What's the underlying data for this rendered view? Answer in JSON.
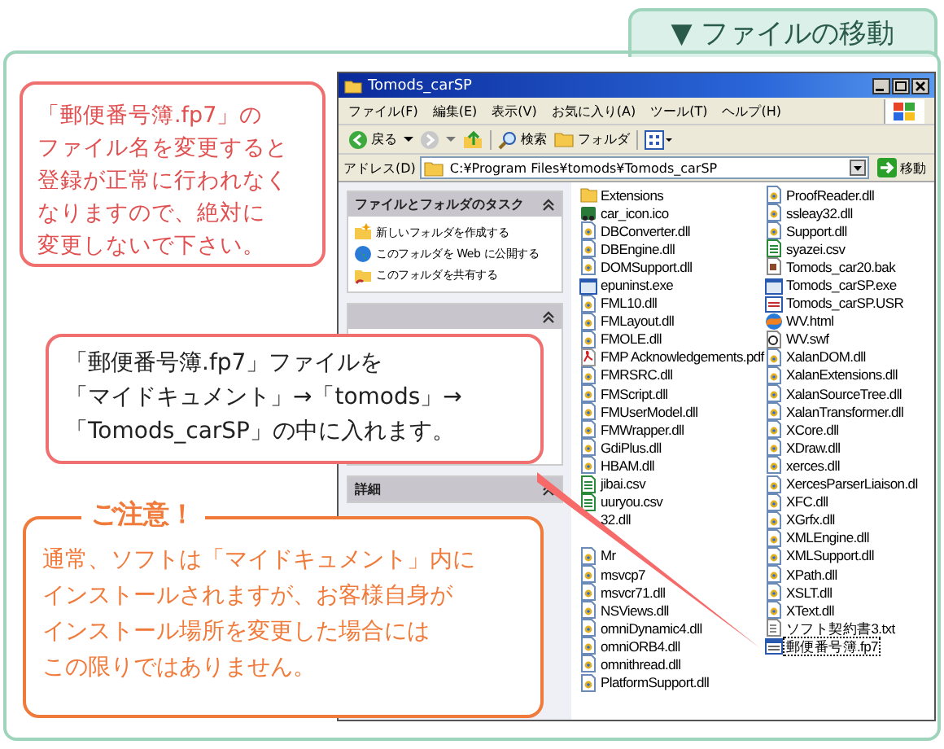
{
  "section_tab": {
    "label": "▼ ファイルの移動"
  },
  "window": {
    "title": "Tomods_carSP",
    "menu": [
      "ファイル(F)",
      "編集(E)",
      "表示(V)",
      "お気に入り(A)",
      "ツール(T)",
      "ヘルプ(H)"
    ],
    "toolbar": [
      {
        "kind": "back",
        "label": "戻る"
      },
      {
        "kind": "forward"
      },
      {
        "kind": "up"
      },
      {
        "kind": "search",
        "label": "検索"
      },
      {
        "kind": "folders",
        "label": "フォルダ"
      },
      {
        "kind": "views"
      }
    ],
    "address": {
      "label": "アドレス(D)",
      "value": "C:¥Program Files¥tomods¥Tomods_carSP",
      "go": "移動"
    },
    "task_panels": [
      {
        "title": "ファイルとフォルダのタスク",
        "expanded": true,
        "items": [
          {
            "kind": "new-folder",
            "label": "新しいフォルダを作成する"
          },
          {
            "kind": "web",
            "label": "このフォルダを Web に公開する"
          },
          {
            "kind": "share",
            "label": "このフォルダを共有する"
          }
        ]
      },
      {
        "expanded": true
      },
      {
        "title": "詳細",
        "expanded": true
      }
    ],
    "file_columns": [
      [
        {
          "name": "Extensions",
          "kind": "folder",
          "selected": false
        },
        {
          "name": "car_icon.ico",
          "kind": "ico",
          "selected": false
        },
        {
          "name": "DBConverter.dll",
          "kind": "dll",
          "selected": false
        },
        {
          "name": "DBEngine.dll",
          "kind": "dll",
          "selected": false
        },
        {
          "name": "DOMSupport.dll",
          "kind": "dll",
          "selected": false
        },
        {
          "name": "epuninst.exe",
          "kind": "exe",
          "selected": false
        },
        {
          "name": "FML10.dll",
          "kind": "dll",
          "selected": false
        },
        {
          "name": "FMLayout.dll",
          "kind": "dll",
          "selected": false
        },
        {
          "name": "FMOLE.dll",
          "kind": "dll",
          "selected": false
        },
        {
          "name": "FMP Acknowledgements.pdf",
          "kind": "pdf",
          "selected": false
        },
        {
          "name": "FMRSRC.dll",
          "kind": "dll",
          "selected": false
        },
        {
          "name": "FMScript.dll",
          "kind": "dll",
          "selected": false
        },
        {
          "name": "FMUserModel.dll",
          "kind": "dll",
          "selected": false
        },
        {
          "name": "FMWrapper.dll",
          "kind": "dll",
          "selected": false
        },
        {
          "name": "GdiPlus.dll",
          "kind": "dll",
          "selected": false
        },
        {
          "name": "HBAM.dll",
          "kind": "dll",
          "selected": false
        },
        {
          "name": "jibai.csv",
          "kind": "csv",
          "selected": false
        },
        {
          "name": "uuryou.csv",
          "kind": "csv",
          "selected": false
        },
        {
          "name": "32.dll",
          "selected": false
        },
        {
          "name": "Mr",
          "kind": "dll",
          "selected": false
        },
        {
          "name": "msvcp7",
          "kind": "dll",
          "selected": false
        },
        {
          "name": "msvcr71.dll",
          "kind": "dll",
          "selected": false
        },
        {
          "name": "NSViews.dll",
          "kind": "dll",
          "selected": false
        },
        {
          "name": "omniDynamic4.dll",
          "kind": "dll",
          "selected": false
        },
        {
          "name": "omniORB4.dll",
          "kind": "dll",
          "selected": false
        },
        {
          "name": "omnithread.dll",
          "kind": "dll",
          "selected": false
        },
        {
          "name": "PlatformSupport.dll",
          "kind": "dll",
          "selected": false
        }
      ],
      [
        {
          "name": "ProofReader.dll",
          "kind": "dll",
          "selected": false
        },
        {
          "name": "ssleay32.dll",
          "kind": "dll",
          "selected": false
        },
        {
          "name": "Support.dll",
          "kind": "dll",
          "selected": false
        },
        {
          "name": "syazei.csv",
          "kind": "csv",
          "selected": false
        },
        {
          "name": "Tomods_car20.bak",
          "kind": "bak",
          "selected": false
        },
        {
          "name": "Tomods_carSP.exe",
          "kind": "exe",
          "selected": false
        },
        {
          "name": "Tomods_carSP.USR",
          "kind": "usr",
          "selected": false
        },
        {
          "name": "WV.html",
          "kind": "html",
          "selected": false
        },
        {
          "name": "WV.swf",
          "kind": "swf",
          "selected": false
        },
        {
          "name": "XalanDOM.dll",
          "kind": "dll",
          "selected": false
        },
        {
          "name": "XalanExtensions.dll",
          "kind": "dll",
          "selected": false
        },
        {
          "name": "XalanSourceTree.dll",
          "kind": "dll",
          "selected": false
        },
        {
          "name": "XalanTransformer.dll",
          "kind": "dll",
          "selected": false
        },
        {
          "name": "XCore.dll",
          "kind": "dll",
          "selected": false
        },
        {
          "name": "XDraw.dll",
          "kind": "dll",
          "selected": false
        },
        {
          "name": "xerces.dll",
          "kind": "dll",
          "selected": false
        },
        {
          "name": "XercesParserLiaison.dl",
          "kind": "dll",
          "selected": false
        },
        {
          "name": "XFC.dll",
          "kind": "dll",
          "selected": false
        },
        {
          "name": "XGrfx.dll",
          "kind": "dll",
          "selected": false
        },
        {
          "name": "XMLEngine.dll",
          "kind": "dll",
          "selected": false
        },
        {
          "name": "XMLSupport.dll",
          "kind": "dll",
          "selected": false
        },
        {
          "name": "XPath.dll",
          "kind": "dll",
          "selected": false
        },
        {
          "name": "XSLT.dll",
          "kind": "dll",
          "selected": false
        },
        {
          "name": "XText.dll",
          "kind": "dll",
          "selected": false
        },
        {
          "name": "ソフト契約書3.txt",
          "kind": "txt",
          "selected": false
        },
        {
          "name": "郵便番号簿.fp7",
          "kind": "fp7",
          "selected": true
        }
      ]
    ]
  },
  "notes": [
    {
      "kind": "warning",
      "lines": [
        "「郵便番号簿.fp7」の",
        "ファイル名を変更すると",
        "登録が正常に行われなく",
        "なりますので、絶対に",
        "変更しないで下さい。"
      ]
    },
    {
      "kind": "instruction",
      "lines": [
        "「郵便番号簿.fp7」ファイルを",
        "「マイドキュメント」→「tomods」→",
        "「Tomods_carSP」の中に入れます。"
      ]
    },
    {
      "kind": "caution",
      "title": "ご注意！",
      "lines": [
        "通常、ソフトは「マイドキュメント」内に",
        "インストールされますが、お客様自身が",
        "インストール場所を変更した場合には",
        "この限りではありません。"
      ]
    }
  ]
}
